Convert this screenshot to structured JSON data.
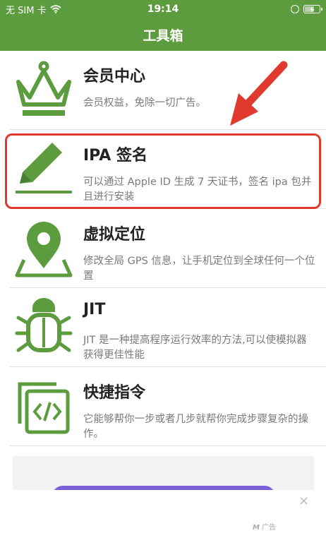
{
  "status_bar": {
    "carrier": "无 SIM 卡",
    "time": "19:14"
  },
  "nav": {
    "title": "工具箱"
  },
  "items": [
    {
      "title": "会员中心",
      "description": "会员权益，免除一切广告。",
      "icon": "crown-icon"
    },
    {
      "title": "IPA 签名",
      "description": "可以通过 Apple ID 生成 7 天证书，签名 ipa 包并且进行安装",
      "icon": "pencil-icon"
    },
    {
      "title": "虚拟定位",
      "description": "修改全局 GPS 信息，让手机定位到全球任何一个位置",
      "icon": "map-pin-icon"
    },
    {
      "title": "JIT",
      "description": "JIT 是一种提高程序运行效率的方法,可以使模拟器获得更佳性能",
      "icon": "bug-icon"
    },
    {
      "title": "快捷指令",
      "description": "它能够帮你一步或者几步就帮你完成步骤复杂的操作。",
      "icon": "shortcuts-code-icon"
    }
  ],
  "ad": {
    "badge": "广告",
    "close": "×"
  },
  "colors": {
    "brand_green": "#5c9c3f",
    "highlight_red": "#e03a2f"
  }
}
